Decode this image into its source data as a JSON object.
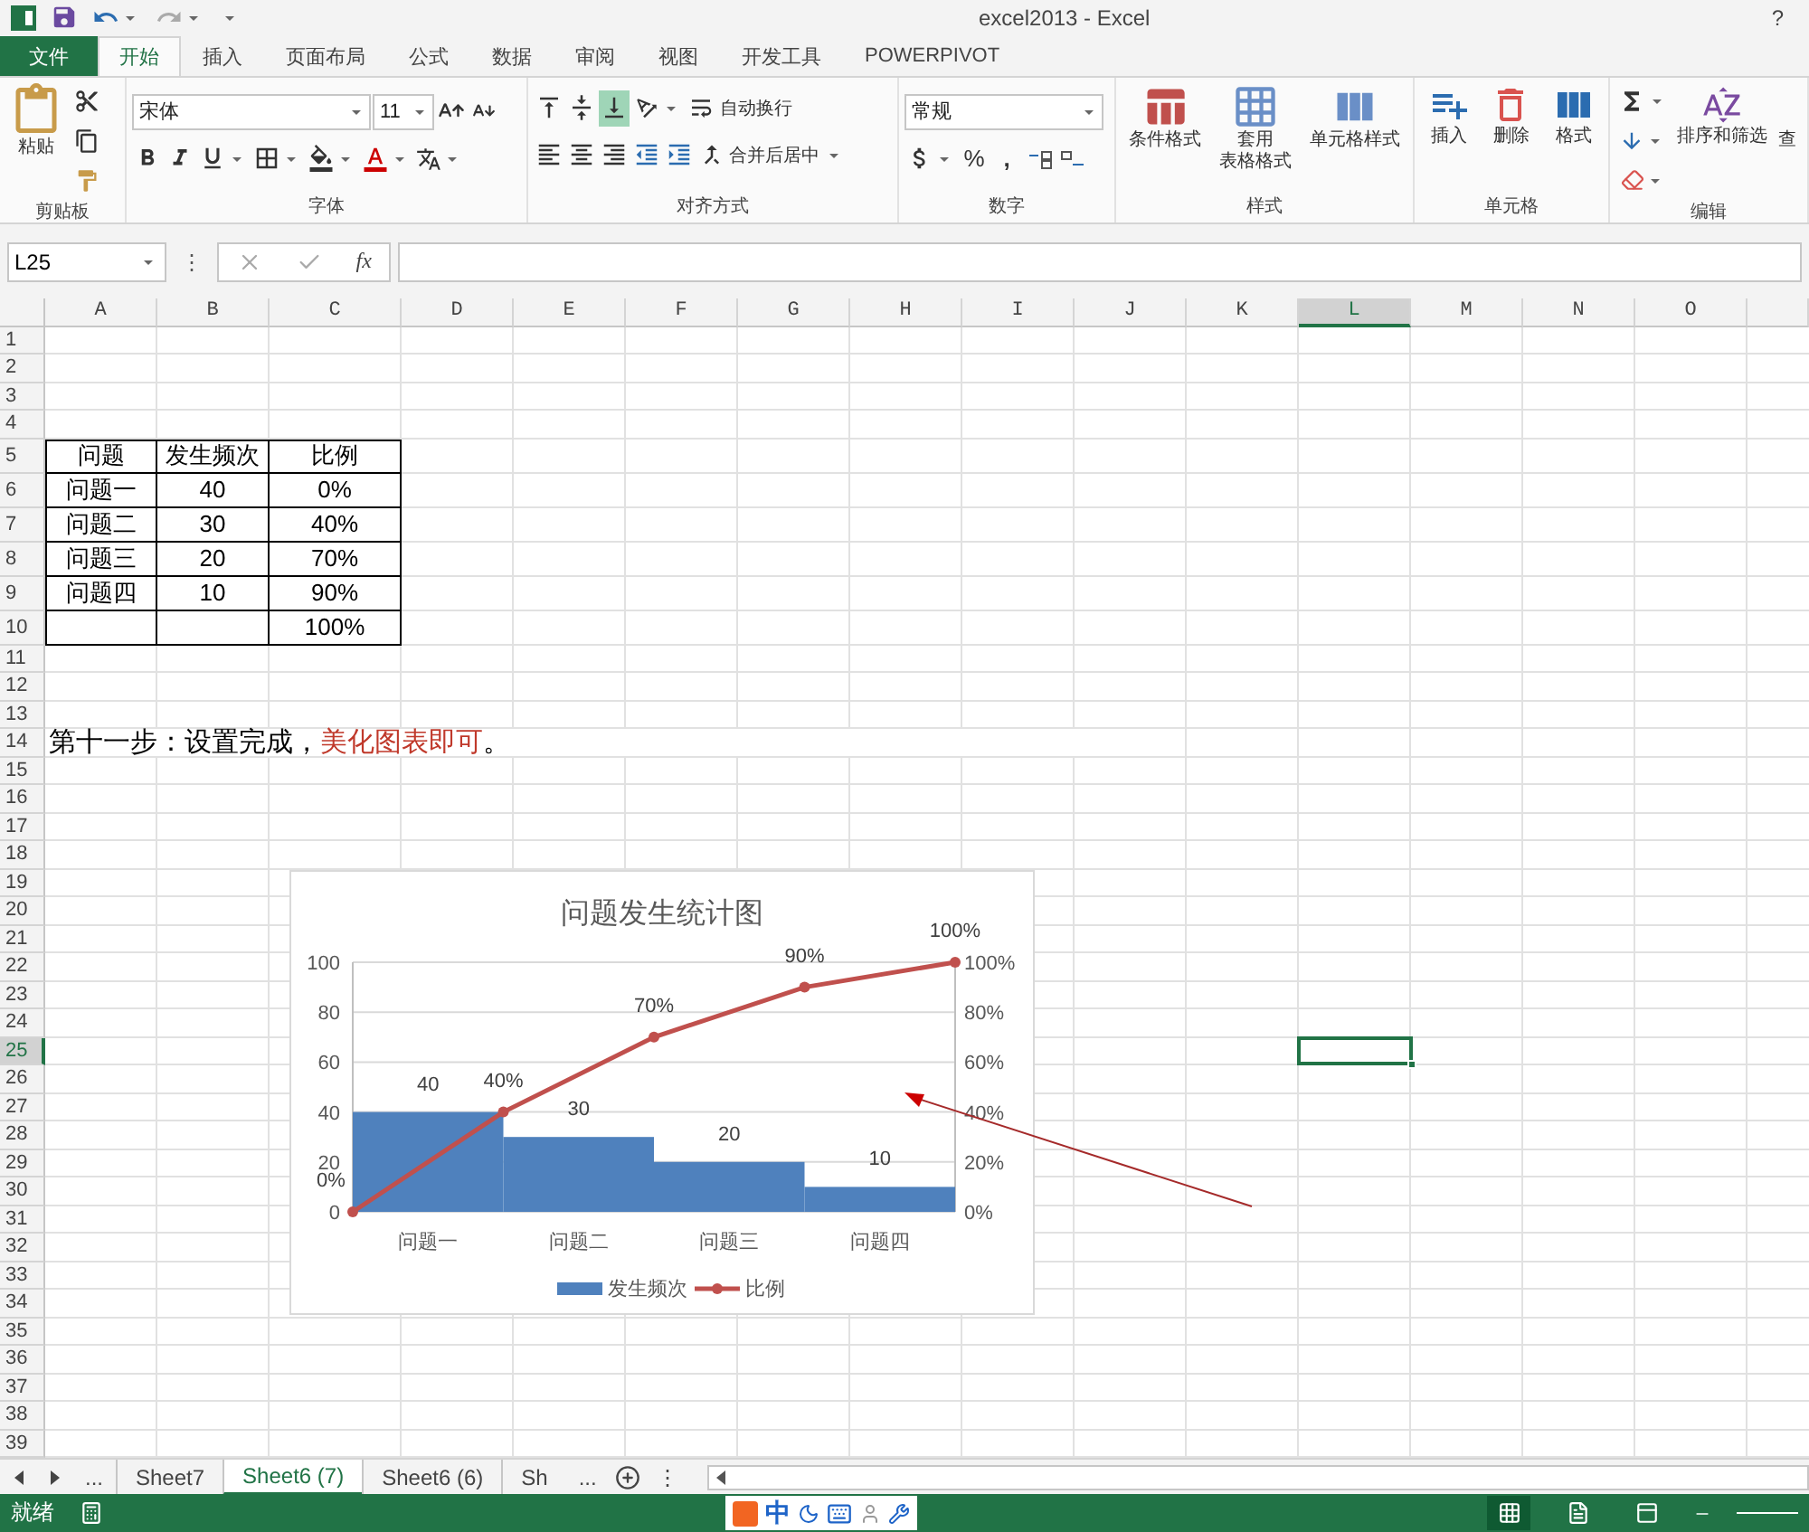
{
  "window": {
    "title": "excel2013 - Excel",
    "help": "?"
  },
  "ribbon_tabs": [
    {
      "label": "文件",
      "kind": "file",
      "selected": false
    },
    {
      "label": "开始",
      "kind": "tab",
      "selected": true
    },
    {
      "label": "插入",
      "kind": "tab",
      "selected": false
    },
    {
      "label": "页面布局",
      "kind": "tab",
      "selected": false
    },
    {
      "label": "公式",
      "kind": "tab",
      "selected": false
    },
    {
      "label": "数据",
      "kind": "tab",
      "selected": false
    },
    {
      "label": "审阅",
      "kind": "tab",
      "selected": false
    },
    {
      "label": "视图",
      "kind": "tab",
      "selected": false
    },
    {
      "label": "开发工具",
      "kind": "tab",
      "selected": false
    },
    {
      "label": "POWERPIVOT",
      "kind": "tab",
      "selected": false
    }
  ],
  "ribbon": {
    "clipboard": {
      "label": "剪贴板",
      "paste": "粘贴"
    },
    "font": {
      "label": "字体",
      "name": "宋体",
      "size": "11"
    },
    "alignment": {
      "label": "对齐方式",
      "wrap": "自动换行",
      "merge": "合并后居中",
      "vertical": [
        {
          "selected": false
        },
        {
          "selected": false
        },
        {
          "selected": true
        }
      ]
    },
    "number": {
      "label": "数字",
      "format": "常规",
      "percent": "%",
      "comma": ","
    },
    "styles": {
      "label": "样式",
      "buttons": [
        {
          "lines": [
            "条件格式"
          ]
        },
        {
          "lines": [
            "套用",
            "表格格式"
          ]
        },
        {
          "lines": [
            "单元格样式"
          ]
        }
      ]
    },
    "cells": {
      "label": "单元格",
      "buttons": [
        "插入",
        "删除",
        "格式"
      ]
    },
    "editing": {
      "label": "编辑",
      "sort": "排序和筛选",
      "find": "查"
    }
  },
  "formula_bar": {
    "name_box": "L25",
    "menu": "⋮",
    "fx": "fx"
  },
  "columns": [
    {
      "label": "A",
      "selected": false
    },
    {
      "label": "B",
      "selected": false
    },
    {
      "label": "C",
      "selected": false
    },
    {
      "label": "D",
      "selected": false
    },
    {
      "label": "E",
      "selected": false
    },
    {
      "label": "F",
      "selected": false
    },
    {
      "label": "G",
      "selected": false
    },
    {
      "label": "H",
      "selected": false
    },
    {
      "label": "I",
      "selected": false
    },
    {
      "label": "J",
      "selected": false
    },
    {
      "label": "K",
      "selected": false
    },
    {
      "label": "L",
      "selected": true
    },
    {
      "label": "M",
      "selected": false
    },
    {
      "label": "N",
      "selected": false
    },
    {
      "label": "O",
      "selected": false
    }
  ],
  "rows": [
    {
      "number": "1",
      "selected": false
    },
    {
      "number": "2",
      "selected": false
    },
    {
      "number": "3",
      "selected": false
    },
    {
      "number": "4",
      "selected": false
    },
    {
      "number": "5",
      "selected": false,
      "cells": [
        "问题",
        "发生频次",
        "比例"
      ]
    },
    {
      "number": "6",
      "selected": false,
      "cells": [
        "问题一",
        "40",
        "0%"
      ]
    },
    {
      "number": "7",
      "selected": false,
      "cells": [
        "问题二",
        "30",
        "40%"
      ]
    },
    {
      "number": "8",
      "selected": false,
      "cells": [
        "问题三",
        "20",
        "70%"
      ]
    },
    {
      "number": "9",
      "selected": false,
      "cells": [
        "问题四",
        "10",
        "90%"
      ]
    },
    {
      "number": "10",
      "selected": false,
      "cells": [
        null,
        null,
        "100%"
      ]
    },
    {
      "number": "11",
      "selected": false
    },
    {
      "number": "12",
      "selected": false
    },
    {
      "number": "13",
      "selected": false
    },
    {
      "number": "14",
      "selected": false,
      "note": {
        "text": "第十一步：设置完成，",
        "highlight": "美化图表即可",
        "tail": "。"
      }
    },
    {
      "number": "15",
      "selected": false
    },
    {
      "number": "16",
      "selected": false
    },
    {
      "number": "17",
      "selected": false
    },
    {
      "number": "18",
      "selected": false
    },
    {
      "number": "19",
      "selected": false
    },
    {
      "number": "20",
      "selected": false
    },
    {
      "number": "21",
      "selected": false
    },
    {
      "number": "22",
      "selected": false
    },
    {
      "number": "23",
      "selected": false
    },
    {
      "number": "24",
      "selected": false
    },
    {
      "number": "25",
      "selected": true
    },
    {
      "number": "26",
      "selected": false
    },
    {
      "number": "27",
      "selected": false
    },
    {
      "number": "28",
      "selected": false
    },
    {
      "number": "29",
      "selected": false
    },
    {
      "number": "30",
      "selected": false
    },
    {
      "number": "31",
      "selected": false
    },
    {
      "number": "32",
      "selected": false
    },
    {
      "number": "33",
      "selected": false
    },
    {
      "number": "34",
      "selected": false
    },
    {
      "number": "35",
      "selected": false
    },
    {
      "number": "36",
      "selected": false
    },
    {
      "number": "37",
      "selected": false
    },
    {
      "number": "38",
      "selected": false
    },
    {
      "number": "39",
      "selected": false
    }
  ],
  "chart": {
    "chart_data": {
      "type": "bar",
      "title": "问题发生统计图",
      "categories": [
        null,
        "问题一",
        null,
        "问题二",
        null,
        "问题三",
        null,
        "问题四",
        null
      ],
      "ylim": [
        0,
        100
      ],
      "yticks": [
        0,
        20,
        40,
        60,
        80,
        100
      ],
      "y2lim": [
        0,
        100
      ],
      "y2ticks": [
        {
          "value": 0,
          "label": "0%"
        },
        {
          "value": 20,
          "label": "20%"
        },
        {
          "value": 40,
          "label": "40%"
        },
        {
          "value": 60,
          "label": "60%"
        },
        {
          "value": 80,
          "label": "80%"
        },
        {
          "value": 100,
          "label": "100%"
        }
      ],
      "grid": true,
      "legend": "bottom",
      "series": [
        {
          "name": "发生频次",
          "color": "#4f81bd",
          "values": [
            null,
            40,
            null,
            30,
            null,
            20,
            null,
            10,
            null
          ],
          "value_labels": [
            null,
            "40",
            null,
            "30",
            null,
            "20",
            null,
            "10",
            null
          ]
        },
        {
          "name": "比例",
          "type": "line",
          "color": "#c0504d",
          "marker": "circle",
          "values": [
            0,
            null,
            40,
            null,
            70,
            null,
            90,
            null,
            100
          ],
          "value_labels": [
            "0%",
            null,
            "40%",
            null,
            "70%",
            null,
            "90%",
            null,
            "100%"
          ]
        }
      ]
    }
  },
  "sheet_tabs": {
    "more_left": "...",
    "tabs": [
      {
        "label": "Sheet7",
        "selected": false
      },
      {
        "label": "Sheet6 (7)",
        "selected": true
      },
      {
        "label": "Sheet6 (6)",
        "selected": false
      },
      {
        "label": "Sh",
        "selected": false
      }
    ],
    "more_right": "...",
    "menu": "⋮"
  },
  "status_bar": {
    "text": "就绪",
    "ime": "中"
  }
}
